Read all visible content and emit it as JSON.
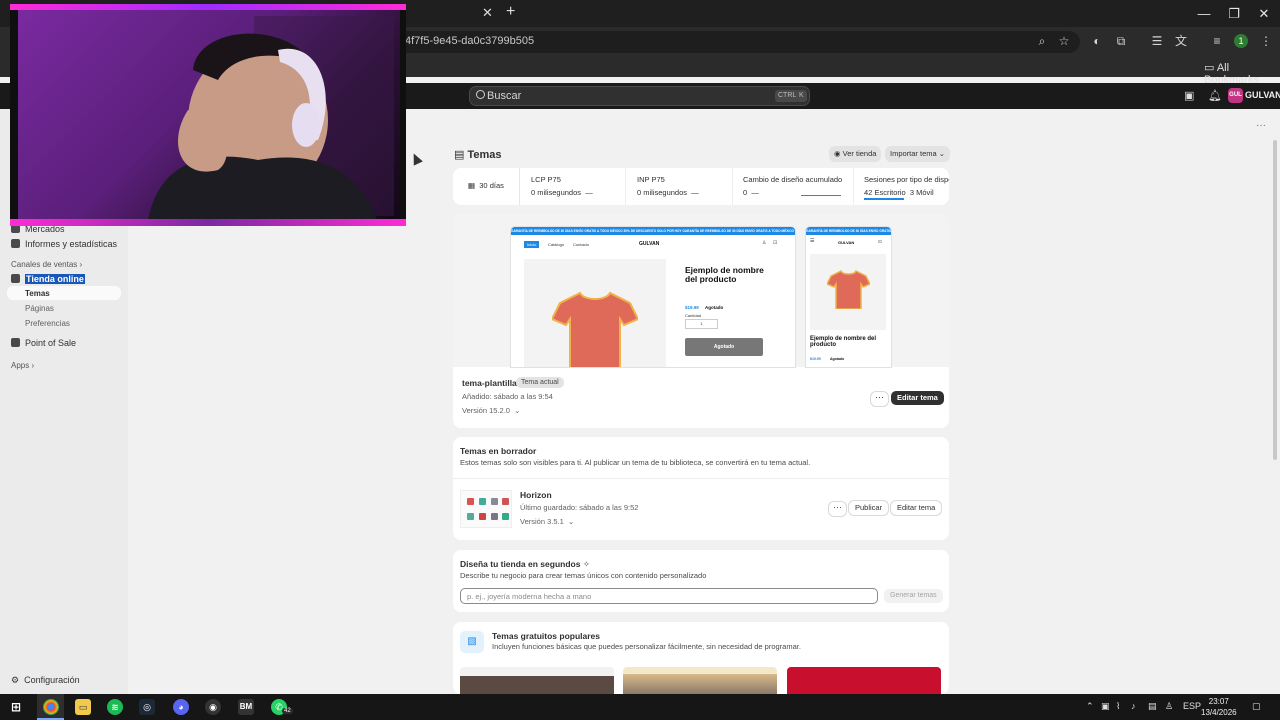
{
  "browser": {
    "url_fragment": "4f7f5-9e45-da0c3799b505",
    "bookmarks_label": "All Bookmarks",
    "profile_initial": "1"
  },
  "topbar": {
    "search_placeholder": "Buscar",
    "shortcut_ctrl": "CTRL",
    "shortcut_k": "K",
    "store_badge": "GUL",
    "store_name": "GULVAN"
  },
  "sidebar": {
    "items": [
      {
        "label": "Mercados"
      },
      {
        "label": "Informes y estadísticas"
      }
    ],
    "channels_label": "Canales de ventas",
    "online_store": "Tienda online",
    "sub_items": [
      "Temas",
      "Páginas",
      "Preferencias"
    ],
    "pos": "Point of Sale",
    "apps": "Apps",
    "settings": "Configuración"
  },
  "page": {
    "title": "Temas",
    "view_store": "Ver tienda",
    "import_theme": "Importar tema"
  },
  "metrics": {
    "range": "30 días",
    "cells": [
      {
        "title": "LCP P75",
        "value": "0 milisegundos",
        "trend": "—"
      },
      {
        "title": "INP P75",
        "value": "0 milisegundos",
        "trend": "—"
      },
      {
        "title": "Cambio de diseño acumulado",
        "value": "0",
        "trend": "—"
      },
      {
        "title": "Sesiones por tipo de dispo",
        "desktop": "42",
        "desktop_label": "Escritorio",
        "mobile": "3",
        "mobile_label": "Móvil"
      }
    ]
  },
  "preview": {
    "announcement": "GARANTÍA DE REEMBOLSO DE 30 DÍAS    ENVÍO GRATIS A TODO MÉXICO    50% DE DESCUENTO SOLO POR HOY    GARANTÍA DE REEMBOLSO DE 30 DÍAS    ENVÍO GRATIS A TODO MÉXICO",
    "nav": [
      "Inicio",
      "Catálogo",
      "Contacto"
    ],
    "brand": "GULVAN",
    "product_title": "Ejemplo de nombre del producto",
    "price": "$19.99",
    "sold_out_label": "Agotado",
    "qty_label": "Cantidad",
    "qty_value": "1",
    "sold_btn": "Agotado",
    "mobile_product_title": "Ejemplo de nombre del producto"
  },
  "current_theme": {
    "name": "tema-plantilla",
    "badge": "Tema actual",
    "added": "Añadido: sábado a las 9:54",
    "version": "Versión 15.2.0",
    "edit": "Editar tema",
    "more": "···"
  },
  "drafts": {
    "title": "Temas en borrador",
    "desc": "Estos temas solo son visibles para ti. Al publicar un tema de tu biblioteca, se convertirá en tu tema actual.",
    "theme_name": "Horizon",
    "saved": "Último guardado: sábado a las 9:52",
    "version": "Versión 3.5.1",
    "publish": "Publicar",
    "edit": "Editar tema",
    "more": "···"
  },
  "design": {
    "title": "Diseña tu tienda en segundos",
    "desc": "Describe tu negocio para crear temas únicos con contenido personalizado",
    "placeholder": "p. ej., joyería moderna hecha a mano",
    "button": "Generar temas"
  },
  "popular": {
    "title": "Temas gratuitos populares",
    "desc": "Incluyen funciones básicas que puedes personalizar fácilmente, sin necesidad de programar."
  },
  "taskbar": {
    "whatsapp_badge": "42",
    "lang": "ESP",
    "time": "23:07",
    "date": "13/4/2026"
  },
  "colors": {
    "accent_blue": "#1e88e5",
    "shirt_red": "#e06a5a",
    "shirt_trim": "#f0b34a",
    "store_badge": "#c13584"
  }
}
